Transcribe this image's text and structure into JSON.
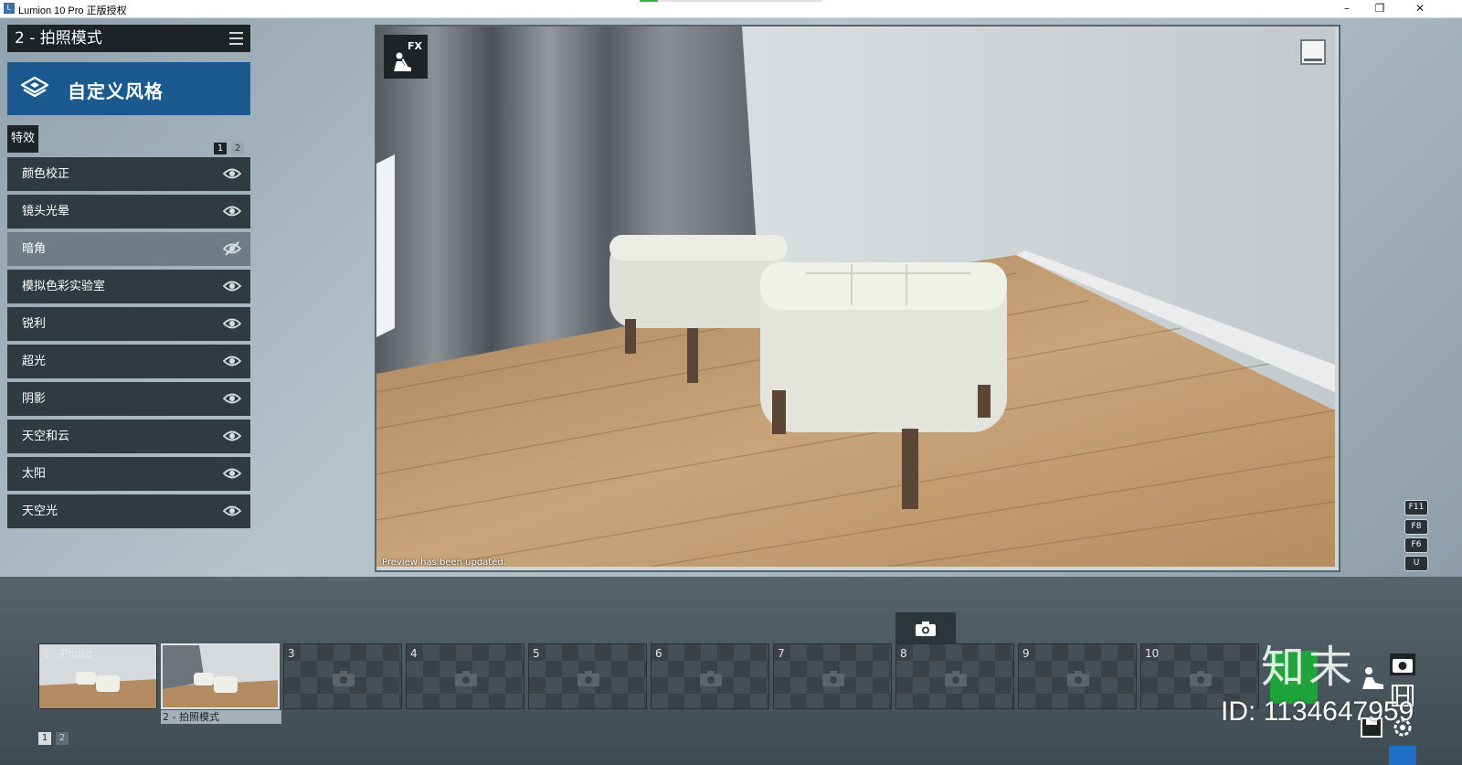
{
  "window": {
    "title": "Lumion 10 Pro 正版授权",
    "minimize": "–",
    "restore": "❐",
    "close": "✕",
    "progress": 0.1
  },
  "left_panel": {
    "mode_title": "2 - 拍照模式",
    "style_banner": "自定义风格",
    "fx_tab": "特效",
    "pages": [
      "1",
      "2"
    ],
    "effects": [
      {
        "label": "颜色校正",
        "visible": true
      },
      {
        "label": "镜头光晕",
        "visible": true
      },
      {
        "label": "暗角",
        "visible": false
      },
      {
        "label": "模拟色彩实验室",
        "visible": true
      },
      {
        "label": "锐利",
        "visible": true
      },
      {
        "label": "超光",
        "visible": true
      },
      {
        "label": "阴影",
        "visible": true
      },
      {
        "label": "天空和云",
        "visible": true
      },
      {
        "label": "太阳",
        "visible": true
      },
      {
        "label": "天空光",
        "visible": true
      }
    ]
  },
  "viewport": {
    "fx_label": "FX",
    "status": "Preview has been updated."
  },
  "shortcuts": [
    "F11",
    "F8",
    "F6",
    "U"
  ],
  "strip": {
    "slots": [
      "1 - Photo",
      "",
      "3",
      "4",
      "5",
      "6",
      "7",
      "8",
      "9",
      "10"
    ],
    "selected_caption": "2 - 拍照模式",
    "pages": [
      "1",
      "2"
    ]
  },
  "watermark": {
    "logo": "知末",
    "id_text": "ID: 1134647959"
  },
  "colors": {
    "accent_blue": "#1a5a8e",
    "panel_dark": "#2f3b41",
    "render_green": "#1fa33a"
  }
}
